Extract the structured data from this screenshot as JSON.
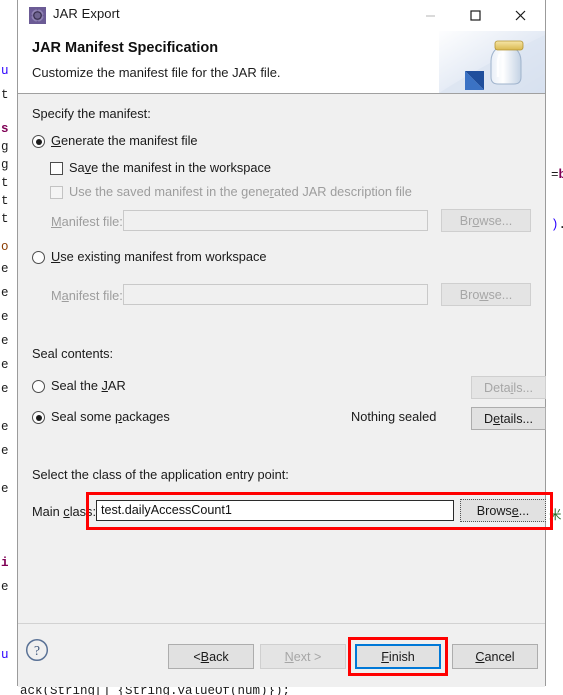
{
  "window": {
    "title": "JAR Export",
    "icon": "jar-export-icon",
    "controls": {
      "minimize": "minimize-icon",
      "maximize": "maximize-icon",
      "close": "close-icon"
    }
  },
  "header": {
    "title": "JAR Manifest Specification",
    "subtitle": "Customize the manifest file for the JAR file.",
    "illustration": "jar-with-arrow-icon"
  },
  "manifest_section": {
    "group_label": "Specify the manifest:",
    "generate": {
      "label": "Generate the manifest file",
      "mnemonic": "G",
      "checked": true
    },
    "save_in_workspace": {
      "label": "Save the manifest in the workspace",
      "mnemonic": "v",
      "checked": false,
      "enabled": true
    },
    "use_saved_manifest": {
      "label": "Use the saved manifest in the generated JAR description file",
      "mnemonic": "r",
      "checked": false,
      "enabled": false
    },
    "generate_file": {
      "label": "Manifest file:",
      "mnemonic": "M",
      "value": "",
      "enabled": false,
      "browse_label": "Browse...",
      "browse_mnemonic": "o",
      "browse_enabled": false
    },
    "use_existing": {
      "label": "Use existing manifest from workspace",
      "mnemonic": "U",
      "checked": false
    },
    "existing_file": {
      "label": "Manifest file:",
      "mnemonic": "a",
      "value": "",
      "enabled": false,
      "browse_label": "Browse...",
      "browse_mnemonic": "w",
      "browse_enabled": false
    }
  },
  "seal_section": {
    "group_label": "Seal contents:",
    "seal_jar": {
      "label": "Seal the JAR",
      "mnemonic": "J",
      "checked": false,
      "details_label": "Details...",
      "details_mnemonic": "i",
      "details_enabled": false
    },
    "seal_packages": {
      "label": "Seal some packages",
      "mnemonic": "p",
      "checked": true,
      "status": "Nothing sealed",
      "details_label": "Details...",
      "details_mnemonic": "e",
      "details_enabled": true
    }
  },
  "entry_point_section": {
    "group_label": "Select the class of the application entry point:",
    "main_class": {
      "label": "Main class:",
      "mnemonic": "c",
      "value": "test.dailyAccessCount1",
      "browse_label": "Browse...",
      "browse_mnemonic": "e"
    }
  },
  "footer": {
    "help_icon": "help-icon",
    "buttons": [
      {
        "name": "back",
        "label": "< Back",
        "mnemonic": "B",
        "enabled": true,
        "focused": false
      },
      {
        "name": "next",
        "label": "Next >",
        "mnemonic": "N",
        "enabled": false,
        "focused": false
      },
      {
        "name": "finish",
        "label": "Finish",
        "mnemonic": "F",
        "enabled": true,
        "focused": true
      },
      {
        "name": "cancel",
        "label": "Cancel",
        "mnemonic": "C",
        "enabled": true,
        "focused": false
      }
    ]
  },
  "annotations": {
    "color": "#ff0000",
    "targets": [
      "main-class-row",
      "finish-button"
    ]
  },
  "background_editor": {
    "lines": [
      "u",
      "t",
      "s",
      "g",
      "g",
      "t",
      "t",
      "t",
      "o",
      "e",
      "e",
      "e",
      "e",
      "e",
      "e",
      "e",
      "e",
      "i",
      "e",
      "u"
    ],
    "bottom_line": "ack(String[] {String.valueOf(num)});"
  },
  "colors": {
    "dialog_bg": "#f0f0f0",
    "header_bg": "#ffffff",
    "accent_focus": "#0078d7",
    "annotation": "#ff0000",
    "text": "#1a1a1a",
    "disabled_text": "#9d9d9d"
  }
}
